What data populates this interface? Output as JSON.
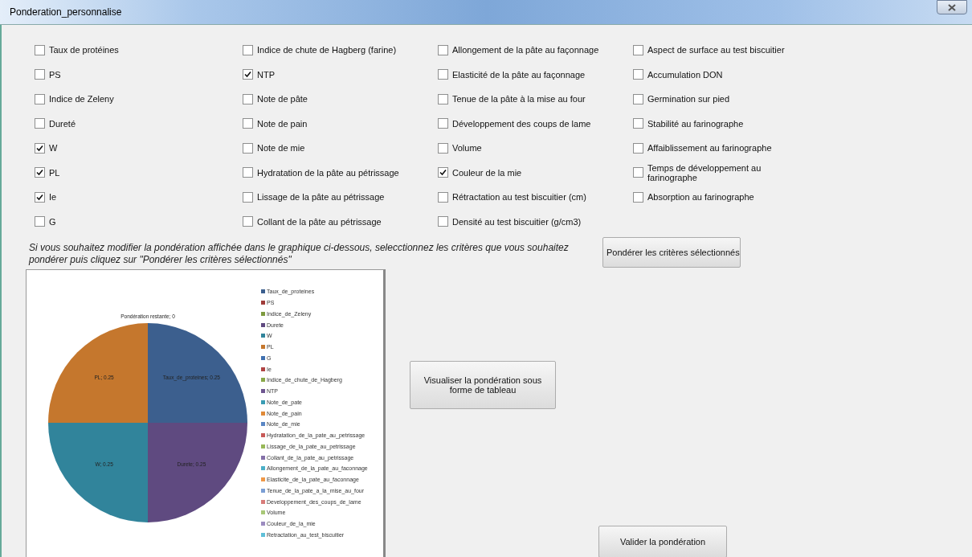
{
  "window": {
    "title": "Ponderation_personnalise"
  },
  "criteria_columns": [
    [
      {
        "label": "Taux de protéines",
        "checked": false
      },
      {
        "label": "PS",
        "checked": false
      },
      {
        "label": "Indice de Zeleny",
        "checked": false
      },
      {
        "label": "Dureté",
        "checked": false
      },
      {
        "label": "W",
        "checked": true
      },
      {
        "label": "PL",
        "checked": true
      },
      {
        "label": "Ie",
        "checked": true
      },
      {
        "label": "G",
        "checked": false
      }
    ],
    [
      {
        "label": "Indice de chute de Hagberg (farine)",
        "checked": false
      },
      {
        "label": "NTP",
        "checked": true
      },
      {
        "label": "Note de pâte",
        "checked": false
      },
      {
        "label": "Note de pain",
        "checked": false
      },
      {
        "label": "Note de mie",
        "checked": false
      },
      {
        "label": "Hydratation de la pâte au pétrissage",
        "checked": false
      },
      {
        "label": "Lissage de la pâte au pétrissage",
        "checked": false
      },
      {
        "label": "Collant de la pâte au pétrissage",
        "checked": false
      }
    ],
    [
      {
        "label": "Allongement de la pâte au façonnage",
        "checked": false
      },
      {
        "label": "Elasticité de la pâte au façonnage",
        "checked": false
      },
      {
        "label": "Tenue de la pâte à la mise au four",
        "checked": false
      },
      {
        "label": "Développement des coups de lame",
        "checked": false
      },
      {
        "label": "Volume",
        "checked": false
      },
      {
        "label": "Couleur de la mie",
        "checked": true
      },
      {
        "label": "Rétractation au test biscuitier (cm)",
        "checked": false
      },
      {
        "label": "Densité au test biscuitier (g/cm3)",
        "checked": false
      }
    ],
    [
      {
        "label": "Aspect de surface au test biscuitier",
        "checked": false
      },
      {
        "label": "Accumulation DON",
        "checked": false
      },
      {
        "label": "Germination sur pied",
        "checked": false
      },
      {
        "label": "Stabilité au farinographe",
        "checked": false
      },
      {
        "label": "Affaiblissement au farinographe",
        "checked": false
      },
      {
        "label": "Temps de développement au farinographe",
        "checked": false
      },
      {
        "label": "Absorption au farinographe",
        "checked": false
      }
    ]
  ],
  "instruction": "Si vous souhaitez modifier la pondération affichée dans le graphique ci-dessous, selecctionnez les critères que vous souhaitez pondérer puis cliquez sur \"Pondérer les critères sélectionnés\"",
  "weight_button": "Pondérer les critères sélectionnés",
  "chart_data": {
    "type": "pie",
    "legend": "right",
    "value_labels": [
      "Taux_de_proteines; 0.25",
      null,
      null,
      "Durete; 0.25",
      "W; 0.25",
      "PL; 0.25",
      null,
      null,
      null,
      null,
      null,
      null,
      null,
      null,
      null,
      null,
      null,
      null,
      null,
      null,
      null,
      null,
      null
    ],
    "categories": [
      "Taux_de_proteines",
      "PS",
      "Indice_de_Zeleny",
      "Durete",
      "W",
      "PL",
      "G",
      "Ie",
      "Indice_de_chute_de_Hagberg",
      "NTP",
      "Note_de_pate",
      "Note_de_pain",
      "Note_de_mie",
      "Hydratation_de_la_pate_au_petrissage",
      "Lissage_de_la_pate_au_petrissage",
      "Collant_de_la_pate_au_petrissage",
      "Allongement_de_la_pate_au_faconnage",
      "Elasticite_de_la_pate_au_faconnage",
      "Tenue_de_la_pate_a_la_mise_au_four",
      "Developpement_des_coups_de_lame",
      "Volume",
      "Couleur_de_la_mie",
      "Retractation_au_test_biscuitier"
    ],
    "colors": [
      "#3c5f8e",
      "#a03c3a",
      "#7d9a3f",
      "#5f4a80",
      "#31849b",
      "#c5772d",
      "#4070b0",
      "#b04444",
      "#88a848",
      "#6e5690",
      "#3a9cb4",
      "#e08a38",
      "#5a86c4",
      "#c85a58",
      "#98b858",
      "#8470a8",
      "#4cb0c8",
      "#f09848",
      "#7a9ed4",
      "#d87c7a",
      "#a8c878",
      "#9c8cc0",
      "#60c0d8"
    ],
    "values": [
      0.25,
      0,
      0,
      0.25,
      0.25,
      0.25,
      0,
      0,
      0,
      0,
      0,
      0,
      0,
      0,
      0,
      0,
      0,
      0,
      0,
      0,
      0,
      0,
      0
    ],
    "annotations": [
      "Pondération restante; 0"
    ]
  },
  "view_button": "Visualiser la pondération sous forme de tableau",
  "validate_button": "Valider la pondération"
}
